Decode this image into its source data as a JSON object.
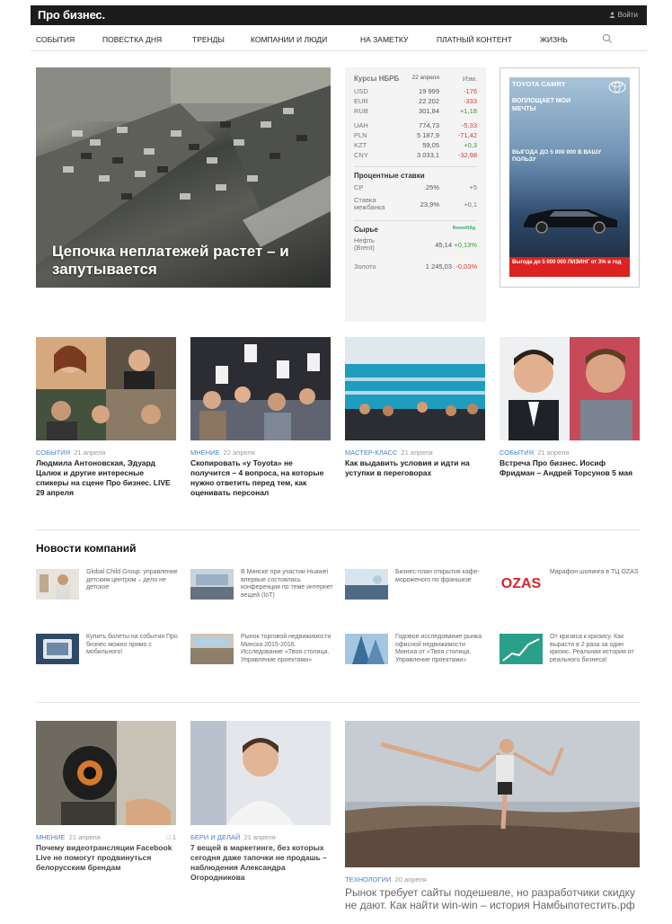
{
  "header": {
    "logo": "Про бизнес.",
    "login": "Войти"
  },
  "nav": {
    "items": [
      {
        "label": "События"
      },
      {
        "label": "Повестка дня"
      },
      {
        "label": "Тренды"
      },
      {
        "label": "Компании и люди"
      },
      {
        "label": "На заметку"
      },
      {
        "label": "Платный контент"
      },
      {
        "label": "Жизнь"
      }
    ]
  },
  "hero": {
    "title": "Цепочка неплатежей растет – и запутывается"
  },
  "rates": {
    "title": "Курсы НБРБ",
    "col_date": "22 апреля",
    "col_change": "Изм.",
    "currencies": [
      {
        "code": "USD",
        "value": "19 999",
        "change": "-176",
        "dir": "neg"
      },
      {
        "code": "EUR",
        "value": "22 202",
        "change": "-333",
        "dir": "neg"
      },
      {
        "code": "RUB",
        "value": "301,84",
        "change": "+1,18",
        "dir": "pos"
      },
      {
        "code": "UAH",
        "value": "774,73",
        "change": "-5,33",
        "dir": "neg"
      },
      {
        "code": "PLN",
        "value": "5 187,9",
        "change": "-71,42",
        "dir": "neg"
      },
      {
        "code": "KZT",
        "value": "59,05",
        "change": "+0,3",
        "dir": "pos"
      },
      {
        "code": "CNY",
        "value": "3 033,1",
        "change": "-32,98",
        "dir": "neg"
      }
    ],
    "rates_title": "Процентные ставки",
    "rates_rows": [
      {
        "label": "СР",
        "value": "25%",
        "change": "+5",
        "dir": "pos"
      },
      {
        "label": "Ставка межбанка",
        "value": "23,9%",
        "change": "+0,1",
        "dir": "pos"
      }
    ],
    "commodities_title": "Сырье",
    "commodities_source": "RosneftAg",
    "commodities": [
      {
        "label": "Нефть (Brent)",
        "value": "45,14",
        "change": "+0,13%",
        "dir": "pos"
      },
      {
        "label": "Золото",
        "value": "1 245,03",
        "change": "-0,03%",
        "dir": "neg"
      }
    ]
  },
  "ad": {
    "brand": "TOYOTA CAMRY",
    "slogan": "Воплощает мои мечты",
    "offer": "Выгода до 5 000 000 в вашу пользу",
    "bottom": "Выгода до 5 000 000 ЛИЗИНГ от 3% в год"
  },
  "cards": [
    {
      "category": "События",
      "date": "21 апреля",
      "title": "Людмила Антоновская, Эдуард Цалюк и другие интересные спикеры на сцене Про бизнес. LIVE 29 апреля"
    },
    {
      "category": "Мнение",
      "date": "22 апреля",
      "title": "Скопировать «у Toyota» не получится – 4 вопроса, на которые нужно ответить перед тем, как оценивать персонал"
    },
    {
      "category": "Мастер-класс",
      "date": "21 апреля",
      "title": "Как выдавить условия и идти на уступки в переговорах"
    },
    {
      "category": "События",
      "date": "21 апреля",
      "title": "Встреча Про бизнес. Иосиф Фридман – Андрей Торсунов 5 мая"
    }
  ],
  "company_news": {
    "title": "Новости компаний",
    "items": [
      {
        "text": "Global Child Group: управление детским центром – дело не детское"
      },
      {
        "text": "В Минске при участии Huawei впервые состоялась конференция по теме интернет вещей (IoT)"
      },
      {
        "text": "Бизнес-план открытия кафе-мороженого по франшизе"
      },
      {
        "logo": "OZAS",
        "text": "Марафон шопинга в ТЦ OZAS"
      },
      {
        "text": "Купить билеты на события Про бизнес можно прямо с мобильного!"
      },
      {
        "text": "Рынок торговой недвижимости Минска 2015-2016. Исследование «Твоя столица. Управление проектами»"
      },
      {
        "text": "Годовое исследование рынка офисной недвижимости Минска от «Твоя столица. Управление проектами»"
      },
      {
        "text": "От кризиса к кризису. Как вырасти в 2 раза за один кризис. Реальная история от реального бизнеса!"
      }
    ]
  },
  "bottom_cards": [
    {
      "category": "Мнение",
      "date": "21 апреля",
      "comments": "1",
      "title": "Почему видеотрансляции Facebook Live не помогут продвинуться белорусским брендам"
    },
    {
      "category": "Бери и делай",
      "date": "21 апреля",
      "title": "7 вещей в маркетинге, без которых сегодня даже тапочки не продашь – наблюдения Александра Огородникова"
    }
  ],
  "big_card": {
    "category": "Технологии",
    "date": "20 апреля",
    "title": "Рынок требует сайты подешевле, но разработчики скидку не дают. Как найти win-win – история Намбыпотестить.рф"
  },
  "colors": {
    "accent": "#4a7fc9",
    "negative": "#d63c3c",
    "positive": "#3c9a3c",
    "header_bg": "#1c1c1c"
  }
}
